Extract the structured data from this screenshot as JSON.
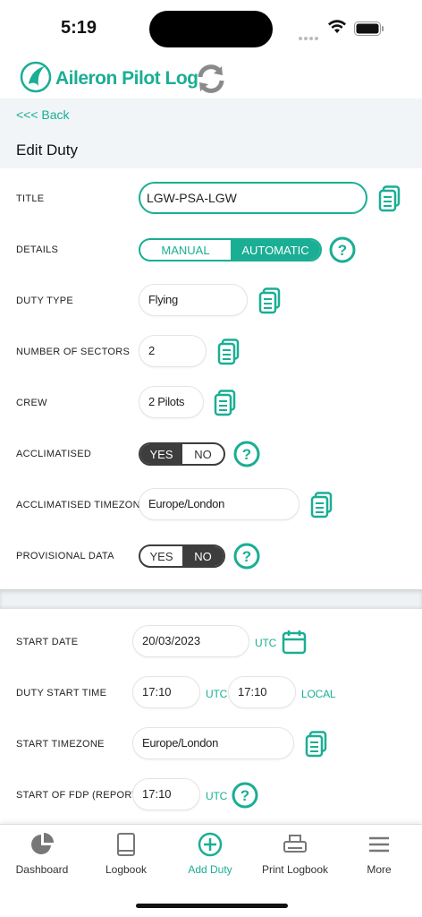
{
  "status": {
    "time": "5:19"
  },
  "app": {
    "name": "Aileron Pilot Log"
  },
  "nav": {
    "back": "<<< Back",
    "title": "Edit Duty"
  },
  "form": {
    "title": {
      "label": "TITLE",
      "value": "LGW-PSA-LGW"
    },
    "details": {
      "label": "DETAILS",
      "options": [
        "MANUAL",
        "AUTOMATIC"
      ],
      "selected": "AUTOMATIC"
    },
    "duty_type": {
      "label": "DUTY TYPE",
      "value": "Flying"
    },
    "sectors": {
      "label": "NUMBER OF SECTORS",
      "value": "2"
    },
    "crew": {
      "label": "CREW",
      "value": "2 Pilots"
    },
    "acclimatised": {
      "label": "ACCLIMATISED",
      "options": [
        "YES",
        "NO"
      ],
      "selected": "YES"
    },
    "acclimatised_tz": {
      "label": "ACCLIMATISED TIMEZONE",
      "value": "Europe/London"
    },
    "provisional": {
      "label": "PROVISIONAL DATA",
      "options": [
        "YES",
        "NO"
      ],
      "selected": "NO"
    }
  },
  "times": {
    "start_date": {
      "label": "START DATE",
      "value": "20/03/2023",
      "unit": "UTC"
    },
    "duty_start": {
      "label": "DUTY START TIME",
      "utc_value": "17:10",
      "utc_unit": "UTC",
      "local_value": "17:10",
      "local_unit": "LOCAL"
    },
    "start_tz": {
      "label": "START TIMEZONE",
      "value": "Europe/London"
    },
    "fdp_start": {
      "label": "START OF FDP (REPORT)",
      "value": "17:10",
      "unit": "UTC"
    }
  },
  "tabs": [
    {
      "label": "Dashboard",
      "icon": "pie-chart-icon"
    },
    {
      "label": "Logbook",
      "icon": "book-icon"
    },
    {
      "label": "Add Duty",
      "icon": "plus-circle-icon"
    },
    {
      "label": "Print Logbook",
      "icon": "printer-icon"
    },
    {
      "label": "More",
      "icon": "menu-icon"
    }
  ],
  "active_tab": "Add Duty",
  "colors": {
    "accent": "#1aae94",
    "dark": "#3d3d3d",
    "nav_bg": "#f1f5f7"
  }
}
